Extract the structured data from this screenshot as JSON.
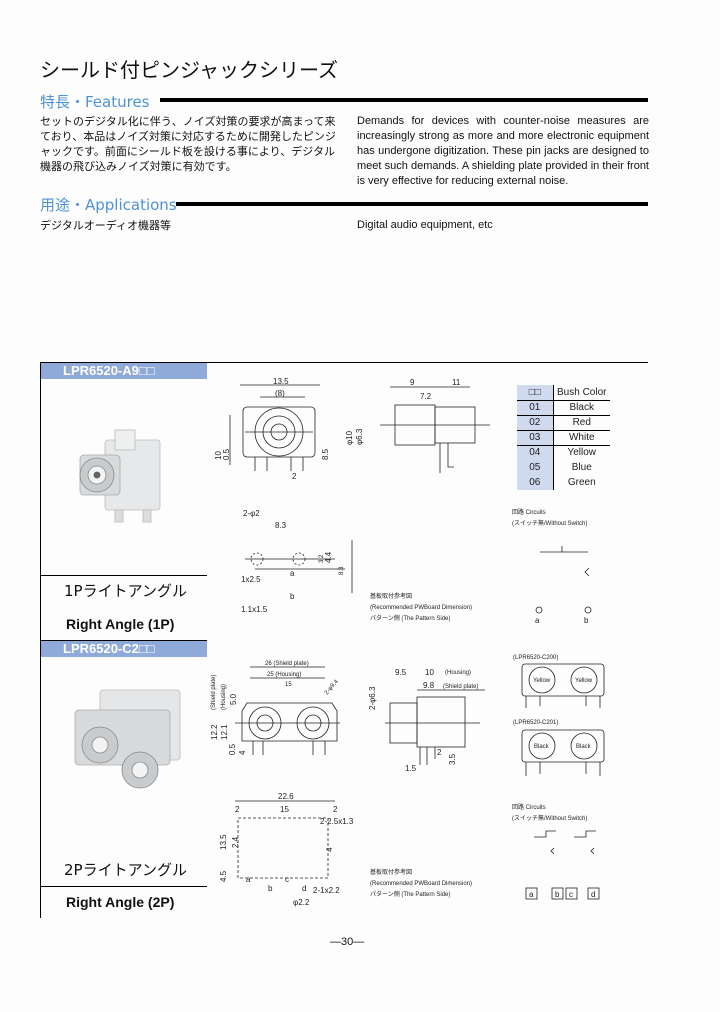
{
  "title": "シールド付ピンジャックシリーズ",
  "features": {
    "heading": "特長・Features",
    "jp": "セットのデジタル化に伴う、ノイズ対策の要求が高まって来ており、本品はノイズ対策に対応するために開発したピンジャックです。前面にシールド板を設ける事により、デジタル機器の飛び込みノイズ対策に有効です。",
    "en": "Demands for devices with counter-noise measures are increasingly strong as more and more electronic equipment has undergone digitization. These pin jacks are designed to meet such demands. A shielding plate provided in their front is very effective for reducing external noise."
  },
  "applications": {
    "heading": "用途・Applications",
    "jp": "デジタルオーディオ機器等",
    "en": "Digital audio equipment, etc"
  },
  "products": [
    {
      "model": "LPR6520-A9",
      "model_suffix": "□□",
      "name_jp": "1Pライトアングル",
      "name_en": "Right Angle (1P)",
      "dims": {
        "w": "13.5",
        "w2": "(8)",
        "h1": "10",
        "h2": "0.5",
        "h3": "8.5",
        "b": "2",
        "d1": "9",
        "d2": "11",
        "d3": "7.2",
        "phi1": "φ10",
        "phi2": "φ6.3",
        "p1": "2-φ2",
        "p2": "8.3",
        "p3": "3.2",
        "p4": "4.4",
        "p5": "8.3",
        "p6": "1x2.5",
        "p7": "1.1x1.5",
        "ma": "a",
        "mb": "b"
      },
      "color_table": {
        "header": [
          "□□",
          "Bush Color"
        ],
        "rows": [
          [
            "01",
            "Black"
          ],
          [
            "02",
            "Red"
          ],
          [
            "03",
            "White"
          ],
          [
            "04",
            "Yellow"
          ],
          [
            "05",
            "Blue"
          ],
          [
            "06",
            "Green"
          ]
        ]
      },
      "circuits": {
        "title": "回路  Circuits",
        "sub": "(スイッチ無/Without Switch)",
        "terms": [
          "a",
          "b"
        ]
      },
      "pcb": {
        "title": "基板取付参考図",
        "sub": "(Recommended PWBoard Dimension)",
        "side": "パターン側 (The Pattern Side)"
      }
    },
    {
      "model": "LPR6520-C2",
      "model_suffix": "□□",
      "name_jp": "2Pライトアングル",
      "name_en": "Right Angle (2P)",
      "dims": {
        "w1": "26 (Shield plate)",
        "w2": "25 (Housing)",
        "w3": "15",
        "hole": "2-φ9.4",
        "h1": "12.2",
        "h2": "12.1",
        "h3": "5.0",
        "h4": "0.5",
        "h5": "4",
        "s1": "(Shield plate)",
        "s2": "(Housing)",
        "phi": "2-φ6.3",
        "d1": "9.5",
        "d2": "10",
        "d2n": "(Housing)",
        "d3": "9.8",
        "d3n": "(Shield plate)",
        "d4": "2",
        "d5": "3.5",
        "d6": "1.5",
        "p1": "22.6",
        "p2": "2",
        "p3": "15",
        "p4": "2",
        "p5": "2-2.5x1.3",
        "p6": "13.5",
        "p7": "2.4",
        "p8": "4.5",
        "p9": "4",
        "p10": "2-1x2.2",
        "p11": "φ2.2",
        "ma": "a",
        "mb": "b",
        "mc": "c",
        "md": "d"
      },
      "variants": [
        {
          "label": "(LPR6520-C200)",
          "color": "Yellow"
        },
        {
          "label": "(LPR6520-C201)",
          "color": "Black"
        }
      ],
      "circuits": {
        "title": "回路  Circuits",
        "sub": "(スイッチ無/Without Switch)",
        "terms": [
          "a",
          "b",
          "c",
          "d"
        ]
      },
      "pcb": {
        "title": "基板取付参考図",
        "sub": "(Recommended PWBoard Dimension)",
        "side": "パターン側 (The Pattern Side)"
      }
    }
  ],
  "page_number": "—30—",
  "colors": {
    "heading": "#4d93d6",
    "band": "#8fa9d8",
    "table_key": "#cfdaee"
  }
}
